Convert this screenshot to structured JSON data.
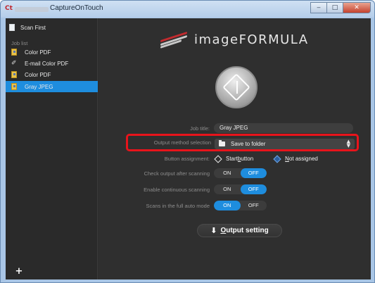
{
  "window": {
    "title": "CaptureOnTouch",
    "app_icon_text": "Ct",
    "controls": {
      "minimize": "‒",
      "maximize": "□",
      "close": "✕"
    }
  },
  "sidebar": {
    "scan_first": "Scan First",
    "job_list_heading": "Job list",
    "jobs": [
      {
        "label": "Color PDF",
        "icon": "document-icon",
        "selected": false
      },
      {
        "label": "E-mail Color PDF",
        "icon": "paperclip-icon",
        "selected": false
      },
      {
        "label": "Color PDF",
        "icon": "document-icon",
        "selected": false
      },
      {
        "label": "Gray JPEG",
        "icon": "document-icon",
        "selected": true
      }
    ],
    "add_label": "+"
  },
  "main": {
    "logo_text": "imageFORMULA",
    "job_title_label": "Job title:",
    "job_title_value": "Gray JPEG",
    "output_method_label": "Output method selection",
    "output_method_value": "Save to folder",
    "button_assignment_label": "Button assignment:",
    "start_button": {
      "prefix": "Start ",
      "underlined": "b",
      "suffix": "utton"
    },
    "not_assigned": {
      "underlined": "N",
      "suffix": "ot assigned"
    },
    "check_output_label": "Check output after scanning",
    "check_output": {
      "on": "ON",
      "off": "OFF",
      "state": "off"
    },
    "continuous_label": "Enable continuous scanning",
    "continuous": {
      "on": "ON",
      "off": "OFF",
      "state": "off"
    },
    "full_auto_label": "Scans in the full auto mode",
    "full_auto": {
      "on": "ON",
      "off": "OFF",
      "state": "on"
    },
    "output_setting": {
      "underlined": "O",
      "suffix": "utput setting"
    }
  },
  "colors": {
    "accent_blue": "#1e8dde",
    "highlight_red": "#e8141b",
    "background_dark": "#2f2f2f"
  }
}
